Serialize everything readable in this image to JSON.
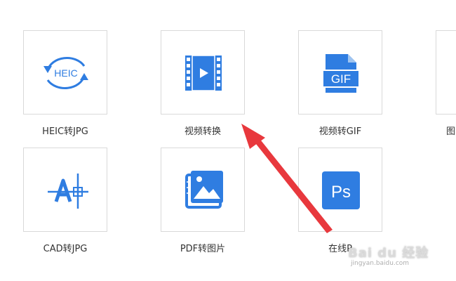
{
  "colors": {
    "accent": "#2f7de1",
    "tile_border": "#d9d9d9",
    "label_text": "#333333",
    "arrow": "#e8383d"
  },
  "tools": [
    {
      "label": "HEIC转JPG",
      "icon": "heic-convert-icon",
      "icon_text": "HEIC"
    },
    {
      "label": "视频转换",
      "icon": "video-film-icon"
    },
    {
      "label": "视频转GIF",
      "icon": "gif-file-icon",
      "icon_text": "GIF"
    },
    {
      "label": "图",
      "icon": "partial-tile"
    },
    {
      "label": "CAD转JPG",
      "icon": "cad-drawing-icon"
    },
    {
      "label": "PDF转图片",
      "icon": "pdf-image-icon"
    },
    {
      "label": "在线P",
      "icon": "photoshop-icon",
      "icon_text": "Ps"
    }
  ],
  "watermark": {
    "brand": "Bai du 经验",
    "url": "jingyan.baidu.com"
  }
}
